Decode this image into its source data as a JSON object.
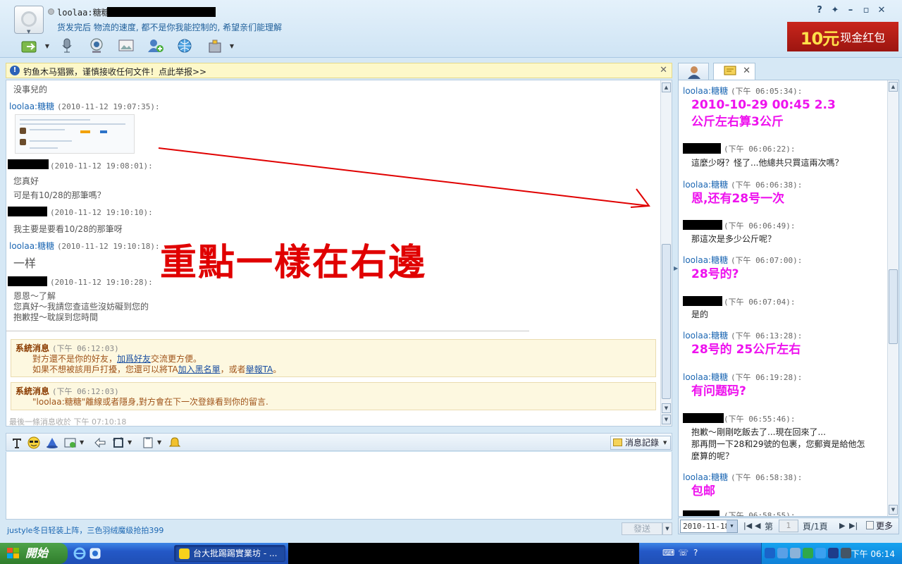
{
  "header": {
    "contact_name": "loolaa:糖糖",
    "signature": "货发完后 物流的速度, 都不是你我能控制的, 希望亲们能理解",
    "promo": {
      "amount": "10元",
      "text": "现金红包"
    }
  },
  "warning": {
    "text": "钓鱼木马猖獗，谨慎接收任何文件！点此举报>>"
  },
  "chat": {
    "messages": [
      {
        "text": "没事兒的"
      },
      {
        "name": "loolaa:糖糖",
        "time": "(2010-11-12 19:07:35):"
      },
      {
        "time": "(2010-11-12 19:08:01):",
        "lines": [
          "您真好",
          "可是有10/28的那筆嗎？"
        ]
      },
      {
        "time": "(2010-11-12 19:10:10):",
        "lines": [
          "我主要是要看10/28的那筆呀"
        ]
      },
      {
        "name": "loolaa:糖糖",
        "time": "(2010-11-12 19:10:18):",
        "lines": [
          "一样"
        ]
      },
      {
        "time": "(2010-11-12 19:10:28):",
        "lines": [
          "恩恩～了解",
          "您真好～我請您查這些沒妨礙到您的",
          "抱歉捏～耽誤到您時間"
        ]
      }
    ],
    "annotation": "重點一樣在右邊",
    "system_messages": [
      {
        "title": "系統消息",
        "time": "(下午 06:12:03)",
        "line1_pre": "對方還不是你的好友，",
        "line1_link": "加爲好友",
        "line1_post": "交流更方便。",
        "line2_pre": "如果不想被該用戶打擾，您還可以將TA",
        "line2_link1": "加入黑名單",
        "line2_mid": "，或者",
        "line2_link2": "舉報TA",
        "line2_post": "。"
      },
      {
        "title": "系統消息",
        "time": "(下午 06:12:03)",
        "line1": "\"loolaa:糖糖\"離線或者隱身,對方會在下一次登錄看到你的留言."
      }
    ],
    "last_msg_info": "最後一條消息收於  下午  07:10:18"
  },
  "input": {
    "history_label": "消息記錄",
    "send_label": "發送",
    "footer_ad": "justyle冬日轻装上阵，三色羽绒魔级抢拍399"
  },
  "history": {
    "entries": [
      {
        "name": "loolaa:糖糖",
        "time": "(下午 06:05:34):",
        "big": [
          "2010-10-29 00:45    2.3",
          "公斤左右算3公斤"
        ]
      },
      {
        "time": "(下午 06:06:22):",
        "norm": [
          "這麼少呀？怪了...他總共只買這兩次嗎？"
        ]
      },
      {
        "name": "loolaa:糖糖",
        "time": "(下午 06:06:38):",
        "big": [
          "恩,还有28号一次"
        ]
      },
      {
        "time": "(下午 06:06:49):",
        "norm": [
          "那這次是多少公斤呢？"
        ]
      },
      {
        "name": "loolaa:糖糖",
        "time": "(下午 06:07:00):",
        "big": [
          "28号的?"
        ]
      },
      {
        "time": "(下午 06:07:04):",
        "norm": [
          "是的"
        ]
      },
      {
        "name": "loolaa:糖糖",
        "time": "(下午 06:13:28):",
        "big": [
          "28号的  25公斤左右"
        ]
      },
      {
        "name": "loolaa:糖糖",
        "time": "(下午 06:19:28):",
        "big": [
          "有问题码?"
        ]
      },
      {
        "time": "(下午 06:55:46):",
        "norm": [
          "抱歉～剛剛吃飯去了...現在回來了...",
          "那再問一下28和29號的包裹，您郵資是給他怎",
          "麼算的呢？"
        ]
      },
      {
        "name": "loolaa:糖糖",
        "time": "(下午 06:58:38):",
        "big": [
          "包邮"
        ]
      },
      {
        "time": "(下午 06:58:55):"
      }
    ],
    "pager": {
      "date": "2010-11-18",
      "page_prefix": "第",
      "page_input": "1",
      "page_suffix": "頁/1頁",
      "more": "更多"
    }
  },
  "taskbar": {
    "start_label": "開始",
    "task_label": "台大批踢踢實業坊 - ...",
    "clock": "下午 06:14"
  },
  "colors": {
    "highlight": "#ee11ee",
    "annotation": "#e00000",
    "link": "#1c67b3"
  }
}
